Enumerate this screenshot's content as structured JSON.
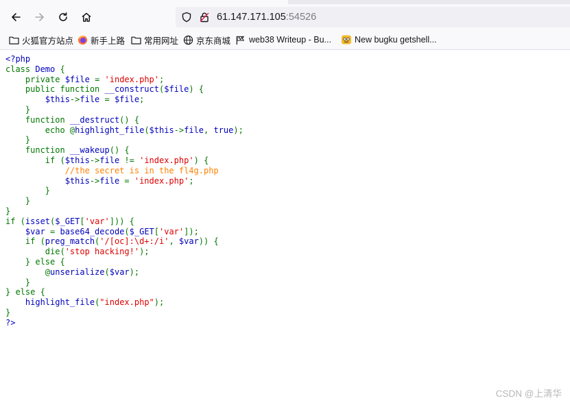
{
  "browser": {
    "url_host": "61.147.171.105",
    "url_port": ":54526"
  },
  "bookmarks": [
    {
      "label": "火狐官方站点",
      "icon": "folder-icon"
    },
    {
      "label": "新手上路",
      "icon": "firefox-icon"
    },
    {
      "label": "常用网址",
      "icon": "folder-icon"
    },
    {
      "label": "京东商城",
      "icon": "globe-icon"
    },
    {
      "label": "web38 Writeup - Bu...",
      "icon": "flag-icon"
    },
    {
      "label": "New bugku getshell...",
      "icon": "bugku-icon"
    }
  ],
  "code_lines": [
    [
      [
        "default",
        "<?php"
      ]
    ],
    [
      [
        "keyword",
        "class "
      ],
      [
        "default",
        "Demo "
      ],
      [
        "keyword",
        "{"
      ]
    ],
    [
      [
        "keyword",
        "    private "
      ],
      [
        "default",
        "$file "
      ],
      [
        "keyword",
        "= "
      ],
      [
        "string",
        "'index.php'"
      ],
      [
        "keyword",
        ";"
      ]
    ],
    [
      [
        "keyword",
        "    public function "
      ],
      [
        "default",
        "__construct"
      ],
      [
        "keyword",
        "("
      ],
      [
        "default",
        "$file"
      ],
      [
        "keyword",
        ") {"
      ]
    ],
    [
      [
        "default",
        "        $this"
      ],
      [
        "keyword",
        "->"
      ],
      [
        "default",
        "file "
      ],
      [
        "keyword",
        "= "
      ],
      [
        "default",
        "$file"
      ],
      [
        "keyword",
        ";"
      ]
    ],
    [
      [
        "keyword",
        "    }"
      ]
    ],
    [
      [
        "keyword",
        "    function "
      ],
      [
        "default",
        "__destruct"
      ],
      [
        "keyword",
        "() {"
      ]
    ],
    [
      [
        "keyword",
        "        echo @"
      ],
      [
        "default",
        "highlight_file"
      ],
      [
        "keyword",
        "("
      ],
      [
        "default",
        "$this"
      ],
      [
        "keyword",
        "->"
      ],
      [
        "default",
        "file"
      ],
      [
        "keyword",
        ", "
      ],
      [
        "default",
        "true"
      ],
      [
        "keyword",
        ");"
      ]
    ],
    [
      [
        "keyword",
        "    }"
      ]
    ],
    [
      [
        "keyword",
        "    function "
      ],
      [
        "default",
        "__wakeup"
      ],
      [
        "keyword",
        "() {"
      ]
    ],
    [
      [
        "keyword",
        "        if ("
      ],
      [
        "default",
        "$this"
      ],
      [
        "keyword",
        "->"
      ],
      [
        "default",
        "file "
      ],
      [
        "keyword",
        "!= "
      ],
      [
        "string",
        "'index.php'"
      ],
      [
        "keyword",
        ") {"
      ]
    ],
    [
      [
        "comment",
        "            //the secret is in the fl4g.php"
      ]
    ],
    [
      [
        "default",
        "            $this"
      ],
      [
        "keyword",
        "->"
      ],
      [
        "default",
        "file "
      ],
      [
        "keyword",
        "= "
      ],
      [
        "string",
        "'index.php'"
      ],
      [
        "keyword",
        ";"
      ]
    ],
    [
      [
        "keyword",
        "        }"
      ]
    ],
    [
      [
        "keyword",
        "    }"
      ]
    ],
    [
      [
        "keyword",
        "}"
      ]
    ],
    [
      [
        "keyword",
        "if ("
      ],
      [
        "default",
        "isset"
      ],
      [
        "keyword",
        "("
      ],
      [
        "default",
        "$_GET"
      ],
      [
        "keyword",
        "["
      ],
      [
        "string",
        "'var'"
      ],
      [
        "keyword",
        "])) {"
      ]
    ],
    [
      [
        "default",
        "    $var "
      ],
      [
        "keyword",
        "= "
      ],
      [
        "default",
        "base64_decode"
      ],
      [
        "keyword",
        "("
      ],
      [
        "default",
        "$_GET"
      ],
      [
        "keyword",
        "["
      ],
      [
        "string",
        "'var'"
      ],
      [
        "keyword",
        "]);"
      ]
    ],
    [
      [
        "keyword",
        "    if ("
      ],
      [
        "default",
        "preg_match"
      ],
      [
        "keyword",
        "("
      ],
      [
        "string",
        "'/[oc]:\\d+:/i'"
      ],
      [
        "keyword",
        ", "
      ],
      [
        "default",
        "$var"
      ],
      [
        "keyword",
        ")) {"
      ]
    ],
    [
      [
        "keyword",
        "        die("
      ],
      [
        "string",
        "'stop hacking!'"
      ],
      [
        "keyword",
        ");"
      ]
    ],
    [
      [
        "keyword",
        "    } else {"
      ]
    ],
    [
      [
        "keyword",
        "        @"
      ],
      [
        "default",
        "unserialize"
      ],
      [
        "keyword",
        "("
      ],
      [
        "default",
        "$var"
      ],
      [
        "keyword",
        ");"
      ]
    ],
    [
      [
        "keyword",
        "    }"
      ]
    ],
    [
      [
        "keyword",
        "} else {"
      ]
    ],
    [
      [
        "keyword",
        "    "
      ],
      [
        "default",
        "highlight_file"
      ],
      [
        "keyword",
        "("
      ],
      [
        "string",
        "\"index.php\""
      ],
      [
        "keyword",
        ");"
      ]
    ],
    [
      [
        "keyword",
        "}"
      ]
    ],
    [
      [
        "default",
        "?>"
      ]
    ]
  ],
  "watermark": "CSDN @上清华"
}
